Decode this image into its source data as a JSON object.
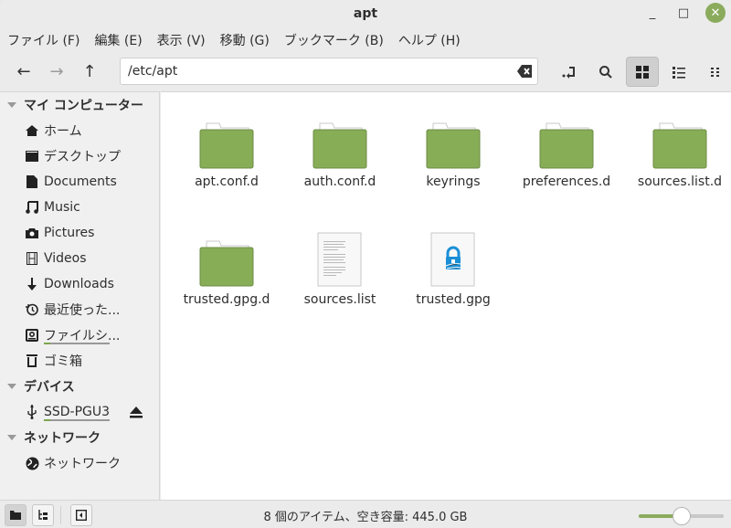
{
  "window": {
    "title": "apt"
  },
  "menu": [
    "ファイル (F)",
    "編集 (E)",
    "表示 (V)",
    "移動 (G)",
    "ブックマーク (B)",
    "ヘルプ (H)"
  ],
  "location": {
    "path": "/etc/apt"
  },
  "sidebar": {
    "sections": [
      {
        "label": "マイ コンピューター",
        "items": [
          {
            "label": "ホーム",
            "icon": "home-icon"
          },
          {
            "label": "デスクトップ",
            "icon": "desktop-icon"
          },
          {
            "label": "Documents",
            "icon": "document-icon"
          },
          {
            "label": "Music",
            "icon": "music-icon"
          },
          {
            "label": "Pictures",
            "icon": "camera-icon"
          },
          {
            "label": "Videos",
            "icon": "film-icon"
          },
          {
            "label": "Downloads",
            "icon": "download-icon"
          },
          {
            "label": "最近使った...",
            "icon": "recent-icon"
          },
          {
            "label": "ファイルシ...",
            "icon": "drive-icon",
            "usage": 0.1
          },
          {
            "label": "ゴミ箱",
            "icon": "trash-icon"
          }
        ]
      },
      {
        "label": "デバイス",
        "items": [
          {
            "label": "SSD-PGU3",
            "icon": "usb-icon",
            "usage": 0.1,
            "eject": true
          }
        ]
      },
      {
        "label": "ネットワーク",
        "items": [
          {
            "label": "ネットワーク",
            "icon": "network-icon"
          }
        ]
      }
    ]
  },
  "files": [
    {
      "name": "apt.conf.d",
      "type": "folder"
    },
    {
      "name": "auth.conf.d",
      "type": "folder"
    },
    {
      "name": "keyrings",
      "type": "folder"
    },
    {
      "name": "preferences.d",
      "type": "folder"
    },
    {
      "name": "sources.list.d",
      "type": "folder"
    },
    {
      "name": "trusted.gpg.d",
      "type": "folder"
    },
    {
      "name": "sources.list",
      "type": "text"
    },
    {
      "name": "trusted.gpg",
      "type": "gpg"
    }
  ],
  "status": {
    "text": "8 個のアイテム、空き容量: 445.0 GB",
    "zoom": 0.5
  },
  "colors": {
    "accent": "#8bab5c",
    "folder": "#87ad57"
  }
}
